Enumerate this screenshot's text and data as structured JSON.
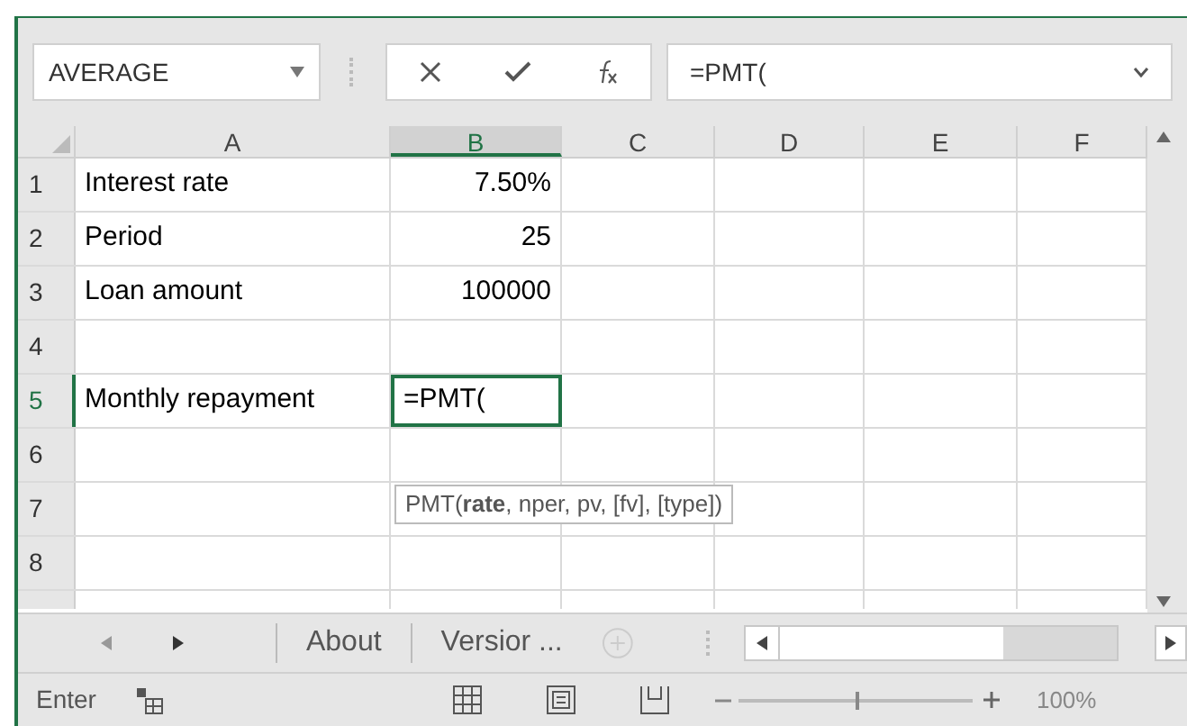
{
  "name_box": "AVERAGE",
  "formula": "=PMT(",
  "columns": [
    {
      "label": "A",
      "selected": false
    },
    {
      "label": "B",
      "selected": true
    },
    {
      "label": "C",
      "selected": false
    },
    {
      "label": "D",
      "selected": false
    },
    {
      "label": "E",
      "selected": false
    },
    {
      "label": "F",
      "selected": false
    }
  ],
  "rows": [
    {
      "header": "1",
      "selected": false,
      "cells": [
        "Interest rate",
        "7.50%"
      ]
    },
    {
      "header": "2",
      "selected": false,
      "cells": [
        "Period",
        "25"
      ]
    },
    {
      "header": "3",
      "selected": false,
      "cells": [
        "Loan amount",
        "100000"
      ]
    },
    {
      "header": "4",
      "selected": false,
      "cells": [
        "",
        ""
      ]
    },
    {
      "header": "5",
      "selected": true,
      "cells": [
        "Monthly repayment",
        "=PMT("
      ]
    },
    {
      "header": "6",
      "selected": false,
      "cells": [
        "",
        ""
      ]
    },
    {
      "header": "7",
      "selected": false,
      "cells": [
        "",
        ""
      ]
    },
    {
      "header": "8",
      "selected": false,
      "cells": [
        "",
        ""
      ]
    }
  ],
  "tooltip": "PMT(**rate**, nper, pv, [fv], [type])",
  "sheet_tabs": [
    {
      "label": "About",
      "selected": false
    },
    {
      "label": "Versior ...",
      "selected": false
    }
  ],
  "status": {
    "mode": "Enter",
    "zoom": {
      "level": 0.5,
      "reading": "100%"
    }
  }
}
